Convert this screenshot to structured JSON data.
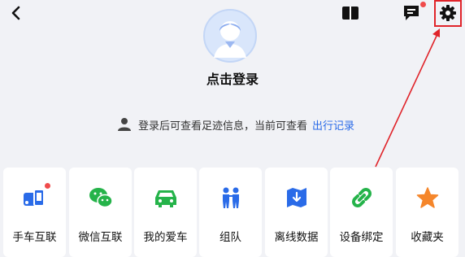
{
  "header": {
    "back_icon": "chevron-left-icon",
    "book_icon": "book-icon",
    "message_icon": "message-icon",
    "settings_icon": "gear-icon"
  },
  "profile": {
    "avatar": "default-user-avatar",
    "login_label": "点击登录"
  },
  "hint": {
    "text": "登录后可查看足迹信息，当前可查看",
    "link": "出行记录"
  },
  "features": [
    {
      "label": "手车互联",
      "icon": "phone-car-link-icon",
      "color": "#2a6be8",
      "badge": true
    },
    {
      "label": "微信互联",
      "icon": "wechat-icon",
      "color": "#25b34a",
      "badge": false
    },
    {
      "label": "我的爱车",
      "icon": "car-icon",
      "color": "#25b34a",
      "badge": false
    },
    {
      "label": "组队",
      "icon": "team-icon",
      "color": "#2a6be8",
      "badge": false
    },
    {
      "label": "离线数据",
      "icon": "offline-map-icon",
      "color": "#2a6be8",
      "badge": false
    },
    {
      "label": "设备绑定",
      "icon": "link-icon",
      "color": "#25b34a",
      "badge": false
    },
    {
      "label": "收藏夹",
      "icon": "star-icon",
      "color": "#f5862b",
      "badge": false
    }
  ],
  "colors": {
    "background": "#f1f2f6",
    "accent_blue": "#2a6be8",
    "accent_green": "#25b34a",
    "accent_orange": "#f5862b",
    "highlight_red": "#e0242a"
  }
}
